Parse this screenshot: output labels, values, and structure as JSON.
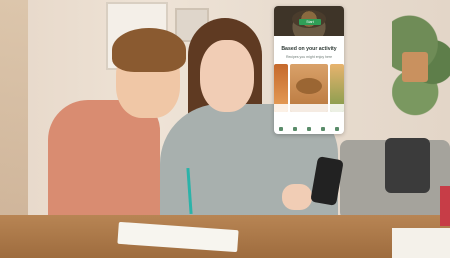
{
  "app_card": {
    "hero_button_label": "Start",
    "title": "Based on your activity",
    "subtitle": "Recipes you might enjoy here",
    "icons": [
      "home-icon",
      "search-icon",
      "recipes-icon",
      "list-icon",
      "profile-icon"
    ]
  },
  "colors": {
    "accent_green": "#2f9e57",
    "card_background": "#ffffff"
  }
}
